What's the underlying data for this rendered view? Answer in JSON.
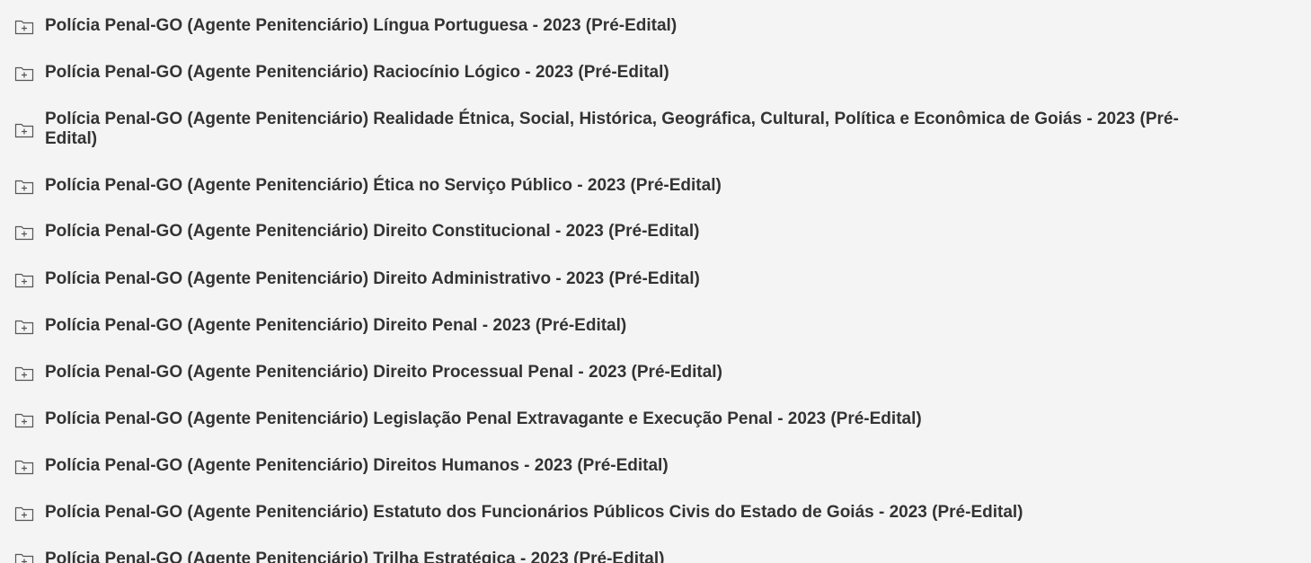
{
  "colors": {
    "background": "#f4f4f4",
    "text": "#333333",
    "icon_stroke": "#555555"
  },
  "folders": [
    {
      "label": "Polícia Penal-GO (Agente Penitenciário) Língua Portuguesa - 2023 (Pré-Edital)",
      "icon": "folder-plus-icon"
    },
    {
      "label": "Polícia Penal-GO (Agente Penitenciário) Raciocínio Lógico - 2023 (Pré-Edital)",
      "icon": "folder-plus-icon"
    },
    {
      "label": "Polícia Penal-GO (Agente Penitenciário) Realidade Étnica, Social, Histórica, Geográfica, Cultural, Política e Econômica de Goiás - 2023 (Pré-Edital)",
      "icon": "folder-plus-icon"
    },
    {
      "label": "Polícia Penal-GO (Agente Penitenciário) Ética no Serviço Público - 2023 (Pré-Edital)",
      "icon": "folder-plus-icon"
    },
    {
      "label": "Polícia Penal-GO (Agente Penitenciário) Direito Constitucional - 2023 (Pré-Edital)",
      "icon": "folder-plus-icon"
    },
    {
      "label": "Polícia Penal-GO (Agente Penitenciário) Direito Administrativo - 2023 (Pré-Edital)",
      "icon": "folder-plus-icon"
    },
    {
      "label": "Polícia Penal-GO (Agente Penitenciário) Direito Penal - 2023 (Pré-Edital)",
      "icon": "folder-plus-icon"
    },
    {
      "label": "Polícia Penal-GO (Agente Penitenciário) Direito Processual Penal - 2023 (Pré-Edital)",
      "icon": "folder-plus-icon"
    },
    {
      "label": "Polícia Penal-GO (Agente Penitenciário) Legislação Penal Extravagante e Execução Penal - 2023 (Pré-Edital)",
      "icon": "folder-plus-icon"
    },
    {
      "label": "Polícia Penal-GO (Agente Penitenciário) Direitos Humanos - 2023 (Pré-Edital)",
      "icon": "folder-plus-icon"
    },
    {
      "label": "Polícia Penal-GO (Agente Penitenciário) Estatuto dos Funcionários Públicos Civis do Estado de Goiás - 2023 (Pré-Edital)",
      "icon": "folder-plus-icon"
    },
    {
      "label": "Polícia Penal-GO (Agente Penitenciário) Trilha Estratégica - 2023 (Pré-Edital)",
      "icon": "folder-plus-icon"
    }
  ]
}
